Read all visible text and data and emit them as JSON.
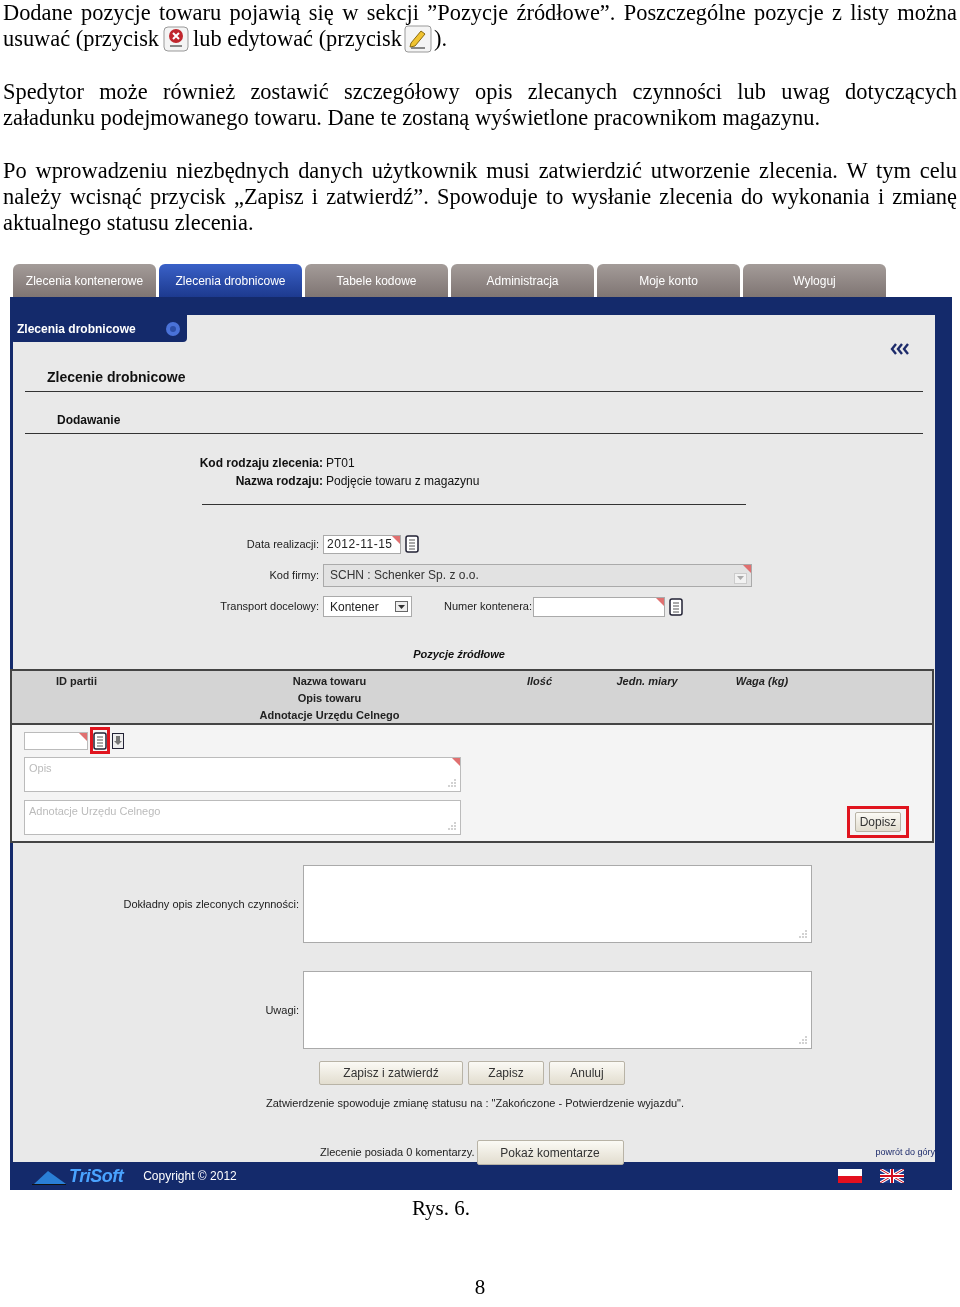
{
  "paragraphs": [
    {
      "lines": [
        [
          {
            "kind": "text",
            "text": "Dodane pozycje towaru pojawią się w sekcji ”Pozycje źródłowe”. Poszczególne pozycje z listy można"
          }
        ],
        [
          {
            "kind": "text",
            "text": "usuwać (przycisk"
          },
          {
            "kind": "delete_icon"
          },
          {
            "kind": "text",
            "text": "lub edytować (przycisk"
          },
          {
            "kind": "edit_icon"
          },
          {
            "kind": "text",
            "text": ")."
          }
        ]
      ]
    },
    {
      "parts": [
        {
          "kind": "text",
          "text": "Spedytor może również zostawić szczegółowy opis zlecanych czynności lub uwag dotyczących załadunku podejmowanego towaru. Dane te zostaną wyświetlone pracownikom magazynu."
        }
      ]
    },
    {
      "parts": [
        {
          "kind": "text",
          "text": "Po wprowadzeniu niezbędnych danych użytkownik musi zatwierdzić utworzenie zlecenia. W tym celu należy wcisnąć przycisk „Zapisz i zatwierdź”. Spowoduje to wysłanie zlecenia do wykonania i zmianę aktualnego statusu zlecenia."
        }
      ]
    }
  ],
  "app": {
    "tabs": [
      {
        "label": "Zlecenia kontenerowe",
        "selected": false
      },
      {
        "label": "Zlecenia drobnicowe",
        "selected": true
      },
      {
        "label": "Tabele kodowe",
        "selected": false
      },
      {
        "label": "Administracja",
        "selected": false
      },
      {
        "label": "Moje konto",
        "selected": false
      },
      {
        "label": "Wyloguj",
        "selected": false
      }
    ],
    "section_tab": "Zlecenia drobnicowe",
    "heading": "Zlecenie drobnicowe",
    "subheading": "Dodawanie",
    "info": [
      {
        "label": "Kod rodzaju zlecenia:",
        "value": "PT01"
      },
      {
        "label": "Nazwa rodzaju:",
        "value": "Podjęcie towaru z magazynu"
      }
    ],
    "form": {
      "date": {
        "label": "Data realizacji:",
        "value": "2012-11-15"
      },
      "company": {
        "label": "Kod firmy:",
        "value": "SCHN : Schenker Sp. z o.o.",
        "disabled": true
      },
      "transport": {
        "label": "Transport docelowy:",
        "value": "Kontener"
      },
      "container": {
        "label": "Numer kontenera:"
      }
    },
    "sources": {
      "title": "Pozycje źródłowe",
      "columns": [
        {
          "lines": [
            "ID partii"
          ],
          "italic": false
        },
        {
          "lines": [
            "Nazwa towaru",
            "Opis towaru",
            "Adnotacje Urzędu Celnego"
          ],
          "italic": false
        },
        {
          "lines": [
            "Ilość"
          ],
          "italic": true
        },
        {
          "lines": [
            "Jedn. miary"
          ],
          "italic": true
        },
        {
          "lines": [
            "Waga (kg)"
          ],
          "italic": true
        }
      ],
      "lookup_highlighted": true,
      "description_placeholder": "Opis",
      "customs_placeholder": "Adnotacje Urzędu Celnego",
      "add_button": {
        "label": "Dopisz",
        "highlighted": true
      }
    },
    "details": [
      {
        "label": "Dokładny opis zleconych czynności:"
      },
      {
        "label": "Uwagi:"
      }
    ],
    "actions": [
      "Zapisz i zatwierdź",
      "Zapisz",
      "Anuluj"
    ],
    "status_note": "Zatwierdzenie spowoduje zmianę statusu na : \"Zakończone - Potwierdzenie wyjazdu\".",
    "comments": {
      "text": "Zlecenie posiada 0 komentarzy.",
      "button": "Pokaż komentarze"
    },
    "back_to_top": "powrót do góry",
    "footer": {
      "logo": "TriSoft",
      "copyright": "Copyright © 2012"
    }
  },
  "caption": "Rys. 6.",
  "page_number": "8"
}
